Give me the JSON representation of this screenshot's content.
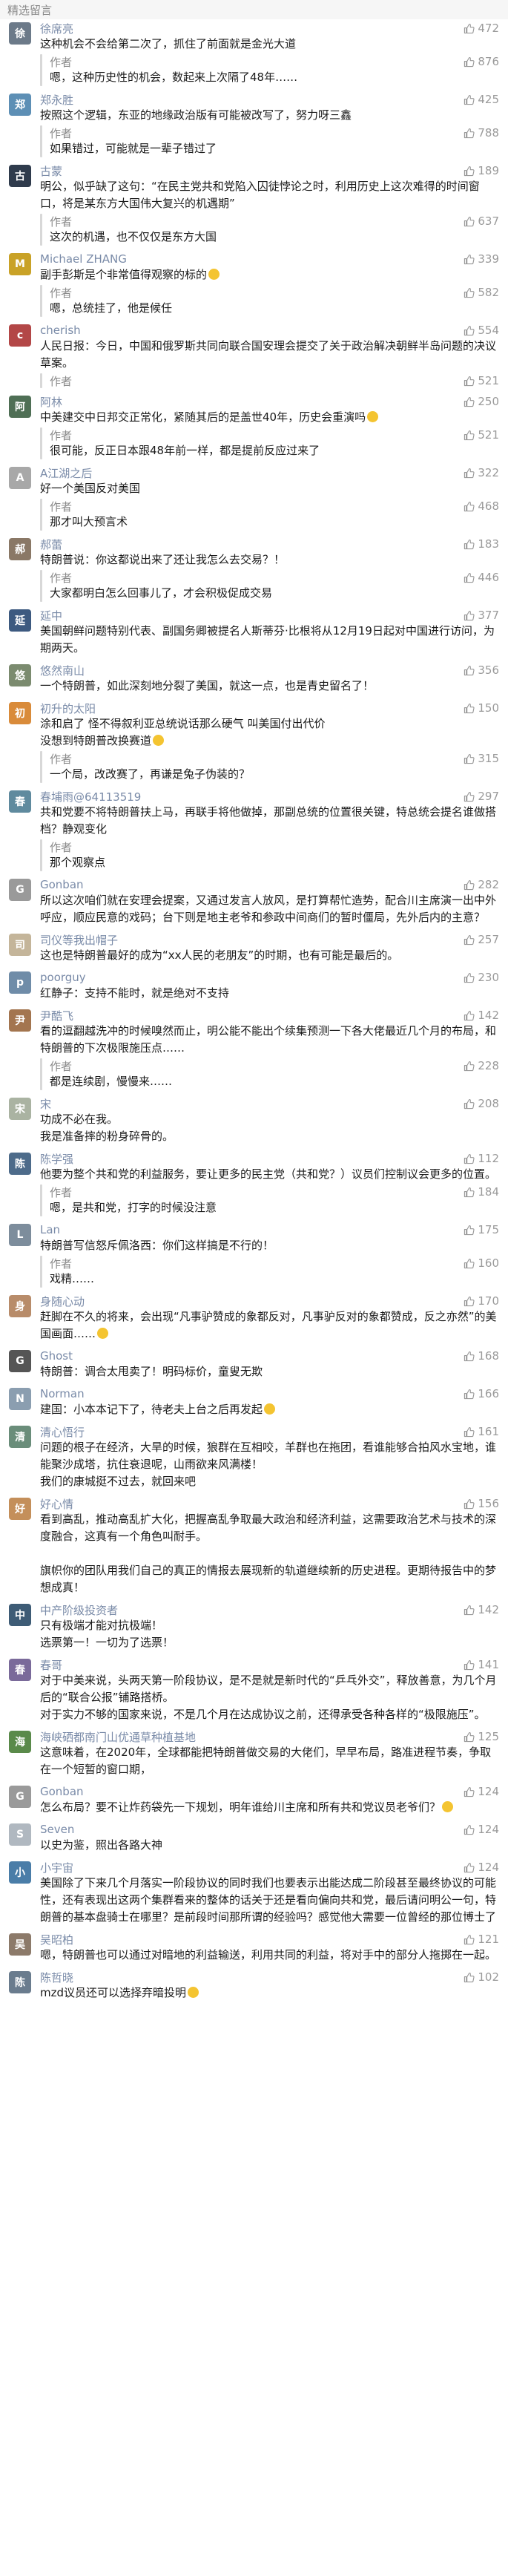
{
  "section_title": "精选留言",
  "comments": [
    {
      "name": "徐席亮",
      "likes": "472",
      "text": "这种机会不会给第二次了，抓住了前面就是金光大道",
      "reply": {
        "label": "作者",
        "likes": "876",
        "text": "嗯，这种历史性的机会，数起来上次隔了48年……"
      },
      "avatar_color": "#6c7a89",
      "avatar_glyph": "徐"
    },
    {
      "name": "郑永胜",
      "likes": "425",
      "text": "按照这个逻辑，东亚的地缘政治版有可能被改写了，努力呀三鑫",
      "reply": {
        "label": "作者",
        "likes": "788",
        "text": "如果错过，可能就是一辈子错过了"
      },
      "avatar_color": "#5d8fb5",
      "avatar_glyph": "郑"
    },
    {
      "name": "古蒙",
      "likes": "189",
      "text": "明公，似乎缺了这句：“在民主党共和党陷入囚徒悖论之时，利用历史上这次难得的时间窗口，将是某东方大国伟大复兴的机遇期”",
      "reply": {
        "label": "作者",
        "likes": "637",
        "text": "这次的机遇，也不仅仅是东方大国"
      },
      "avatar_color": "#2f3b4c",
      "avatar_glyph": "古"
    },
    {
      "name": "Michael ZHANG",
      "likes": "339",
      "text": "副手彭斯是个非常值得观察的标的",
      "reply": {
        "label": "作者",
        "likes": "582",
        "text": "嗯，总统挂了，他是候任"
      },
      "avatar_color": "#c9a227",
      "avatar_glyph": "M",
      "emoji": true
    },
    {
      "name": "cherish",
      "likes": "554",
      "text": "人民日报：今日，中国和俄罗斯共同向联合国安理会提交了关于政治解决朝鲜半岛问题的决议草案。",
      "reply": {
        "label": "作者",
        "likes": "521",
        "text": ""
      },
      "avatar_color": "#b34747",
      "avatar_glyph": "c",
      "no_reply_text": true
    },
    {
      "name": "阿林",
      "likes": "250",
      "text": "中美建交中日邦交正常化，紧随其后的是盖世40年，历史会重演吗",
      "reply": {
        "label": "作者",
        "likes": "521",
        "text": "很可能，反正日本跟48年前一样，都是提前反应过来了"
      },
      "avatar_color": "#4f6f55",
      "avatar_glyph": "阿",
      "emoji": true
    },
    {
      "name": "A江湖之后",
      "likes": "322",
      "text": "好一个美国反对美国",
      "reply": {
        "label": "作者",
        "likes": "468",
        "text": "那才叫大预言术"
      },
      "avatar_color": "#a8a8a8",
      "avatar_glyph": "A"
    },
    {
      "name": "郝蕾",
      "likes": "183",
      "text": "特朗普说：你这都说出来了还让我怎么去交易？！",
      "reply": {
        "label": "作者",
        "likes": "446",
        "text": "大家都明白怎么回事儿了，才会积极促成交易"
      },
      "avatar_color": "#8a7866",
      "avatar_glyph": "郝"
    },
    {
      "name": "延中",
      "likes": "377",
      "text": "美国朝鲜问题特别代表、副国务卿被提名人斯蒂芬·比根将从12月19日起对中国进行访问，为期两天。",
      "reply": null,
      "avatar_color": "#3d5a80",
      "avatar_glyph": "延"
    },
    {
      "name": "悠然南山",
      "likes": "356",
      "text": "一个特朗普，如此深刻地分裂了美国，就这一点，也是青史留名了！",
      "reply": null,
      "avatar_color": "#7b8b6f",
      "avatar_glyph": "悠"
    },
    {
      "name": "初升的太阳",
      "likes": "150",
      "text": "涂和启了  怪不得叙利亚总统说话那么硬气  叫美国付出代价\n没想到特朗普改换赛道",
      "reply": {
        "label": "作者",
        "likes": "315",
        "text": "一个局，改改赛了，再谦是兔子伪装的？"
      },
      "avatar_color": "#d98b3a",
      "avatar_glyph": "初",
      "emoji": true
    },
    {
      "name": "春埔雨@64113519",
      "likes": "297",
      "text": "共和党要不将特朗普扶上马，再联手将他做掉，那副总统的位置很关键，特总统会提名谁做搭档？静观变化",
      "reply": {
        "label": "作者",
        "likes": "",
        "text": "那个观察点"
      },
      "avatar_color": "#5f8a9e",
      "avatar_glyph": "春"
    },
    {
      "name": "Gonban",
      "likes": "282",
      "text": "所以这次咱们就在安理会提案，又通过发言人放风，是打算帮忙造势，配合川主席演一出中外呼应，顺应民意的戏码；台下则是地主老爷和参政中间商们的暂时僵局，先外后内的主意？",
      "reply": null,
      "avatar_color": "#9a9a9a",
      "avatar_glyph": "G"
    },
    {
      "name": "司仪等我出帽子",
      "likes": "257",
      "text": "这也是特朗普最好的成为“xx人民的老朋友”的时期，也有可能是最后的。",
      "reply": null,
      "avatar_color": "#c4b59a",
      "avatar_glyph": "司"
    },
    {
      "name": "poorguy",
      "likes": "230",
      "text": "红静子：支持不能时，就是绝对不支持",
      "reply": null,
      "avatar_color": "#6f8ca8",
      "avatar_glyph": "p"
    },
    {
      "name": "尹酷飞",
      "likes": "142",
      "text": "看的逗翻越洗冲的时候嗅然而止，明公能不能出个续集预测一下各大佬最近几个月的布局，和特朗普的下次极限施压点……",
      "reply": {
        "label": "作者",
        "likes": "228",
        "text": "都是连续剧，慢慢来……"
      },
      "avatar_color": "#a3754f",
      "avatar_glyph": "尹"
    },
    {
      "name": "宋",
      "likes": "208",
      "text": "功成不必在我。\n我是准备摔的粉身碎骨的。",
      "reply": null,
      "avatar_color": "#aab3a2",
      "avatar_glyph": "宋"
    },
    {
      "name": "陈学强",
      "likes": "112",
      "text": "他要为整个共和党的利益服务，要让更多的民主党（共和党？）议员们控制议会更多的位置。",
      "reply": {
        "label": "作者",
        "likes": "184",
        "text": "嗯，是共和党，打字的时候没注意"
      },
      "avatar_color": "#4d6b8a",
      "avatar_glyph": "陈"
    },
    {
      "name": "Lan",
      "likes": "175",
      "text": "特朗普写信怒斥佩洛西：你们这样搞是不行的！",
      "reply": {
        "label": "作者",
        "likes": "160",
        "text": "戏精……"
      },
      "avatar_color": "#7d8d9c",
      "avatar_glyph": "L"
    },
    {
      "name": "身随心动",
      "likes": "170",
      "text": "赶脚在不久的将来，会出现“凡事驴赞成的象都反对，凡事驴反对的象都赞成，反之亦然”的美国画面……",
      "reply": null,
      "avatar_color": "#b88c6a",
      "avatar_glyph": "身",
      "emoji": true
    },
    {
      "name": "Ghost",
      "likes": "168",
      "text": "特朗普：调合太甩卖了！明码标价，童叟无欺",
      "reply": null,
      "avatar_color": "#555555",
      "avatar_glyph": "G"
    },
    {
      "name": "Norman",
      "likes": "166",
      "text": "建国：小本本记下了，待老夫上台之后再发起",
      "reply": null,
      "avatar_color": "#8b9eb0",
      "avatar_glyph": "N",
      "emoji": true
    },
    {
      "name": "清心悟行",
      "likes": "161",
      "text": "问题的根子在经济，大旱的时候，狼群在互相咬，羊群也在拖团，看谁能够合拍风水宝地，谁能聚沙成塔，抗住衰退呢，山雨欲来风满楼！\n我们的康城挺不过去，就回来吧",
      "reply": null,
      "avatar_color": "#6a8d7a",
      "avatar_glyph": "清"
    },
    {
      "name": "好心情",
      "likes": "156",
      "text": "看到高乱，推动高乱扩大化，把握高乱争取最大政治和经济利益，这需要政治艺术与技术的深度融合，这真有一个角色叫耐手。\n\n旗帜你的团队用我们自己的真正的情报去展现新的轨道继续新的历史进程。更期待报告中的梦想成真！",
      "reply": null,
      "avatar_color": "#c48f5a",
      "avatar_glyph": "好"
    },
    {
      "name": "中产阶级投资者",
      "likes": "142",
      "text": "只有极端才能对抗极端！\n选票第一！一切为了选票！",
      "reply": null,
      "avatar_color": "#3e5c76",
      "avatar_glyph": "中"
    },
    {
      "name": "春哥",
      "likes": "141",
      "text": "对于中美来说，头两天第一阶段协议，是不是就是新时代的“乒乓外交”，释放善意，为几个月后的“联合公报”铺路搭桥。\n对于实力不够的国家来说，不是几个月在达成协议之前，还得承受各种各样的“极限施压”。",
      "reply": null,
      "avatar_color": "#7a6a9a",
      "avatar_glyph": "春"
    },
    {
      "name": "海峡硒都南门山优通草种植基地",
      "likes": "125",
      "text": "这意味着，在2020年，全球都能把特朗普做交易的大佬们，早早布局，路准进程节奏，争取在一个短暂的窗口期，",
      "reply": null,
      "avatar_color": "#5a8a4a",
      "avatar_glyph": "海"
    },
    {
      "name": "Gonban",
      "likes": "124",
      "text": "怎么布局？要不让炸药袋先一下规划，明年谁给川主席和所有共和党议员老爷们？",
      "reply": null,
      "avatar_color": "#9a9a9a",
      "avatar_glyph": "G",
      "emoji": true
    },
    {
      "name": "Seven",
      "likes": "124",
      "text": "以史为鉴，照出各路大神",
      "reply": null,
      "avatar_color": "#b0b8c0",
      "avatar_glyph": "S"
    },
    {
      "name": "小宇宙",
      "likes": "124",
      "text": "美国除了下来几个月落实一阶段协议的同时我们也要表示出能达成二阶段甚至最终协议的可能性，还有表现出这两个集群看来的整体的话关于还是看向偏向共和党，最后请问明公一句，特朗普的基本盘骑士在哪里？是前段时间那所谓的经验吗？感觉他大需要一位曾经的那位博士了",
      "reply": null,
      "avatar_color": "#4a7da8",
      "avatar_glyph": "小"
    },
    {
      "name": "吴昭柏",
      "likes": "121",
      "text": "嗯，特朗普也可以通过对暗地的利益输送，利用共同的利益，将对手中的部分人拖掷在一起。",
      "reply": null,
      "avatar_color": "#8c7a6a",
      "avatar_glyph": "吴"
    },
    {
      "name": "陈哲晓",
      "likes": "102",
      "text": "mzd议员还可以选择弃暗投明",
      "reply": null,
      "avatar_color": "#6a7c8e",
      "avatar_glyph": "陈",
      "emoji": true
    }
  ]
}
